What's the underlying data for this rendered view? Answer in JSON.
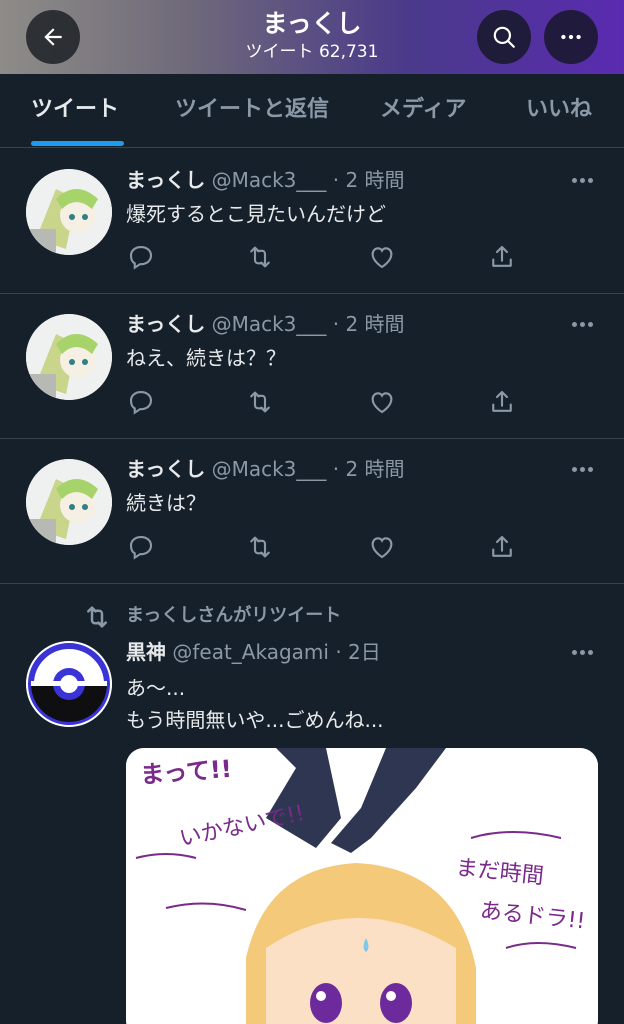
{
  "header": {
    "title": "まっくし",
    "subtitle": "ツイート 62,731"
  },
  "tabs": [
    {
      "label": "ツイート",
      "active": true
    },
    {
      "label": "ツイートと返信",
      "active": false
    },
    {
      "label": "メディア",
      "active": false
    },
    {
      "label": "いいね",
      "active": false
    }
  ],
  "tweets": [
    {
      "name": "まっくし",
      "meta": "@Mack3___ · 2 時間",
      "text": "爆死するとこ見たいんだけど"
    },
    {
      "name": "まっくし",
      "meta": "@Mack3___ · 2 時間",
      "text": "ねえ、続きは？？"
    },
    {
      "name": "まっくし",
      "meta": "@Mack3___ · 2 時間",
      "text": "続きは？"
    }
  ],
  "retweet": {
    "label": "まっくしさんがリツイート",
    "name": "黒神",
    "meta": "@feat_Akagami · 2日",
    "text_line1": "あ〜...",
    "text_line2": "もう時間無いや...ごめんね...",
    "image_texts": [
      "まって!!",
      "いかないで!!",
      "まだ時間",
      "あるドラ!!"
    ]
  },
  "icons": {
    "back": "arrow-left-icon",
    "search": "search-icon",
    "more": "more-horizontal-icon",
    "reply": "reply-icon",
    "retweet": "retweet-icon",
    "like": "heart-icon",
    "share": "share-icon"
  },
  "colors": {
    "background": "#15202b",
    "accent": "#1d9bf0",
    "secondary_text": "#8b98a5"
  }
}
